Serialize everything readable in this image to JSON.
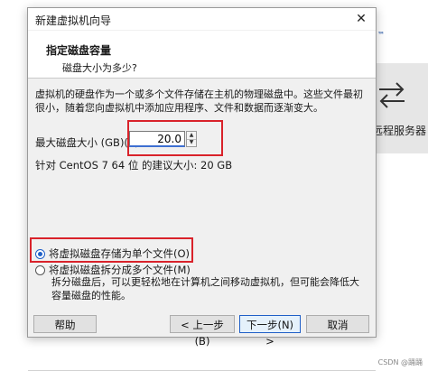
{
  "window": {
    "title": "新建虚拟机向导"
  },
  "header": {
    "title": "指定磁盘容量",
    "subtitle": "磁盘大小为多少?"
  },
  "description": "虚拟机的硬盘作为一个或多个文件存储在主机的物理磁盘中。这些文件最初很小，随着您向虚拟机中添加应用程序、文件和数据而逐渐变大。",
  "disk": {
    "max_size_label": "最大磁盘大小 (GB)(S):",
    "max_size_value": "20.0",
    "recommend_text": "针对 CentOS 7 64 位 的建议大小: 20 GB"
  },
  "storage_options": {
    "single_file_label": "将虚拟磁盘存储为单个文件(O)",
    "single_file_checked": true,
    "split_files_label": "将虚拟磁盘拆分成多个文件(M)",
    "split_files_checked": false,
    "split_description": "拆分磁盘后，可以更轻松地在计算机之间移动虚拟机，但可能会降低大容量磁盘的性能。"
  },
  "buttons": {
    "help": "帮助",
    "back": "< 上一步(B)",
    "next": "下一步(N) >",
    "cancel": "取消"
  },
  "background": {
    "tm": "™",
    "remote_label": "远程服务器"
  },
  "watermark": "CSDN @踊踊",
  "colors": {
    "highlight": "#d9222a",
    "accent": "#1f5fc7"
  }
}
